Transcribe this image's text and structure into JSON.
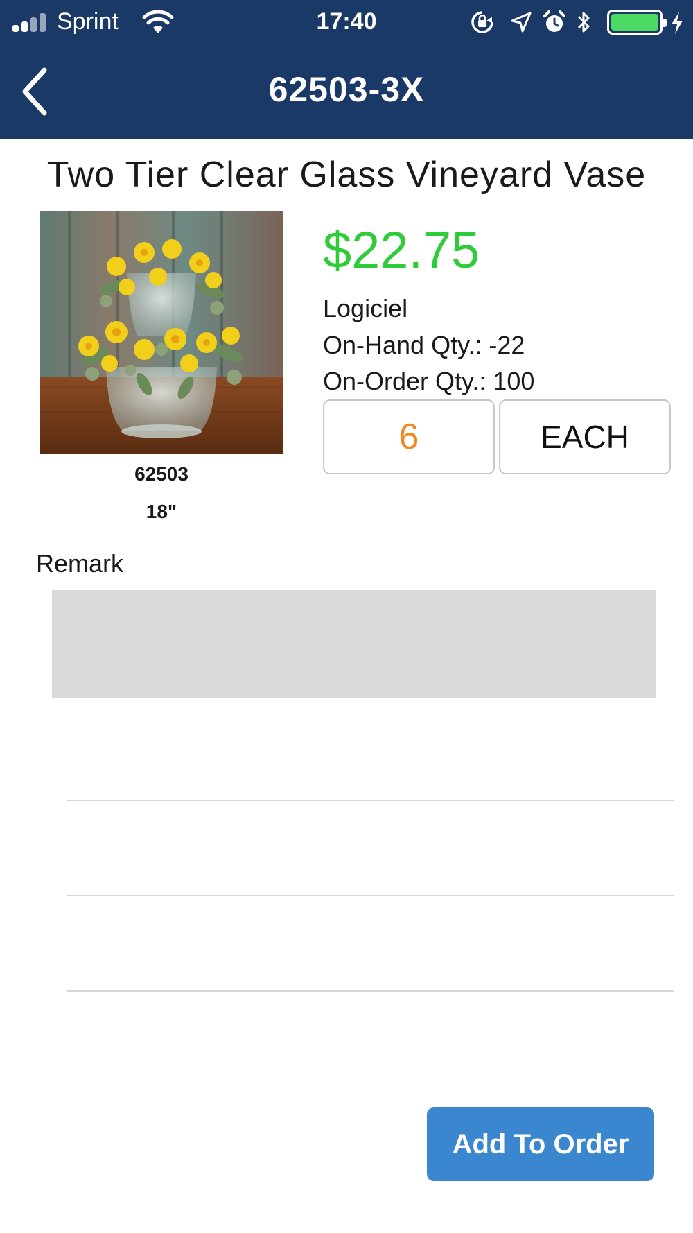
{
  "status_bar": {
    "carrier": "Sprint",
    "time": "17:40",
    "icons": [
      "signal-icon",
      "wifi-icon",
      "rotation-lock-icon",
      "location-icon",
      "alarm-icon",
      "bluetooth-icon",
      "battery-icon",
      "charging-icon"
    ],
    "battery_level": 1.0
  },
  "nav": {
    "title": "62503-3X",
    "back_icon": "chevron-left-icon"
  },
  "product": {
    "title": "Two Tier Clear Glass Vineyard Vase",
    "caption_sku": "62503",
    "caption_size": "18\"",
    "price": "$22.75",
    "vendor": "Logiciel",
    "on_hand": "On-Hand Qty.: -22",
    "on_order": "On-Order Qty.: 100",
    "quantity": "6",
    "unit": "EACH"
  },
  "remark": {
    "label": "Remark",
    "value": ""
  },
  "actions": {
    "add_to_order": "Add To Order"
  },
  "colors": {
    "header_bg": "#1b3966",
    "price": "#2fcc3a",
    "quantity": "#f5891f",
    "button_bg": "#3a87cf",
    "remark_bg": "#d9d9d9"
  }
}
